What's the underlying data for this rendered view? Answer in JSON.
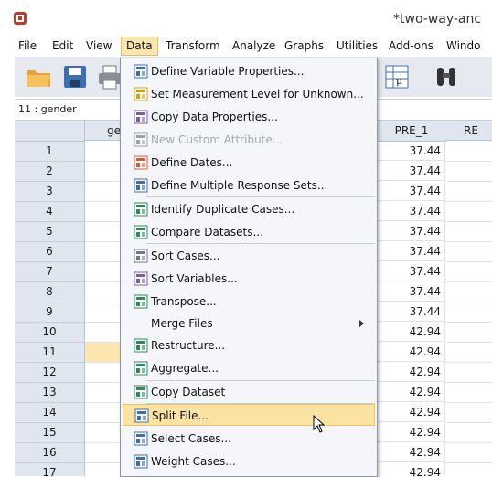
{
  "window": {
    "title": "*two-way-anc"
  },
  "menubar": {
    "items": [
      "File",
      "Edit",
      "View",
      "Data",
      "Transform",
      "Analyze",
      "Graphs",
      "Utilities",
      "Add-ons",
      "Windo"
    ],
    "active": "Data"
  },
  "varbar": {
    "label": "11 : gender"
  },
  "grid": {
    "col_labels": {
      "gender": "ge",
      "pre1": "PRE_1",
      "re": "RE"
    },
    "rows": [
      {
        "n": "1",
        "pre": "37.44"
      },
      {
        "n": "2",
        "pre": "37.44"
      },
      {
        "n": "3",
        "pre": "37.44"
      },
      {
        "n": "4",
        "pre": "37.44"
      },
      {
        "n": "5",
        "pre": "37.44"
      },
      {
        "n": "6",
        "pre": "37.44"
      },
      {
        "n": "7",
        "pre": "37.44"
      },
      {
        "n": "8",
        "pre": "37.44"
      },
      {
        "n": "9",
        "pre": "37.44"
      },
      {
        "n": "10",
        "pre": "42.94"
      },
      {
        "n": "11",
        "pre": "42.94"
      },
      {
        "n": "12",
        "pre": "42.94"
      },
      {
        "n": "13",
        "pre": "42.94"
      },
      {
        "n": "14",
        "pre": "42.94"
      },
      {
        "n": "15",
        "pre": "42.94"
      },
      {
        "n": "16",
        "pre": "42.94"
      },
      {
        "n": "17",
        "pre": "42.94"
      }
    ],
    "selected_row": "11"
  },
  "data_menu": {
    "items": [
      {
        "label": "Define Variable Properties...",
        "icon": "define-variable-properties-icon"
      },
      {
        "label": "Set Measurement Level for Unknown...",
        "icon": "measurement-level-icon"
      },
      {
        "label": "Copy Data Properties...",
        "icon": "copy-data-properties-icon"
      },
      {
        "label": "New Custom Attribute...",
        "icon": "custom-attribute-icon",
        "disabled": true
      },
      {
        "label": "Define Dates...",
        "icon": "calendar-icon"
      },
      {
        "label": "Define Multiple Response Sets...",
        "icon": "multiple-response-icon"
      },
      {
        "label": "Identify Duplicate Cases...",
        "icon": "duplicate-cases-icon"
      },
      {
        "label": "Compare Datasets...",
        "icon": "compare-datasets-icon"
      },
      {
        "label": "Sort Cases...",
        "icon": "sort-cases-icon"
      },
      {
        "label": "Sort Variables...",
        "icon": "sort-variables-icon"
      },
      {
        "label": "Transpose...",
        "icon": "transpose-icon"
      },
      {
        "label": "Merge Files",
        "icon": "",
        "submenu": true
      },
      {
        "label": "Restructure...",
        "icon": "restructure-icon"
      },
      {
        "label": "Aggregate...",
        "icon": "aggregate-icon"
      },
      {
        "label": "Copy Dataset",
        "icon": "copy-dataset-icon"
      },
      {
        "label": "Split File...",
        "icon": "split-file-icon",
        "hover": true
      },
      {
        "label": "Select Cases...",
        "icon": "select-cases-icon"
      },
      {
        "label": "Weight Cases...",
        "icon": "weight-cases-icon"
      }
    ]
  },
  "colors": {
    "accent_hover": "#fbe3a3",
    "header_bg": "#dfe6ef",
    "toolbar_bg": "#e6eaf0"
  }
}
